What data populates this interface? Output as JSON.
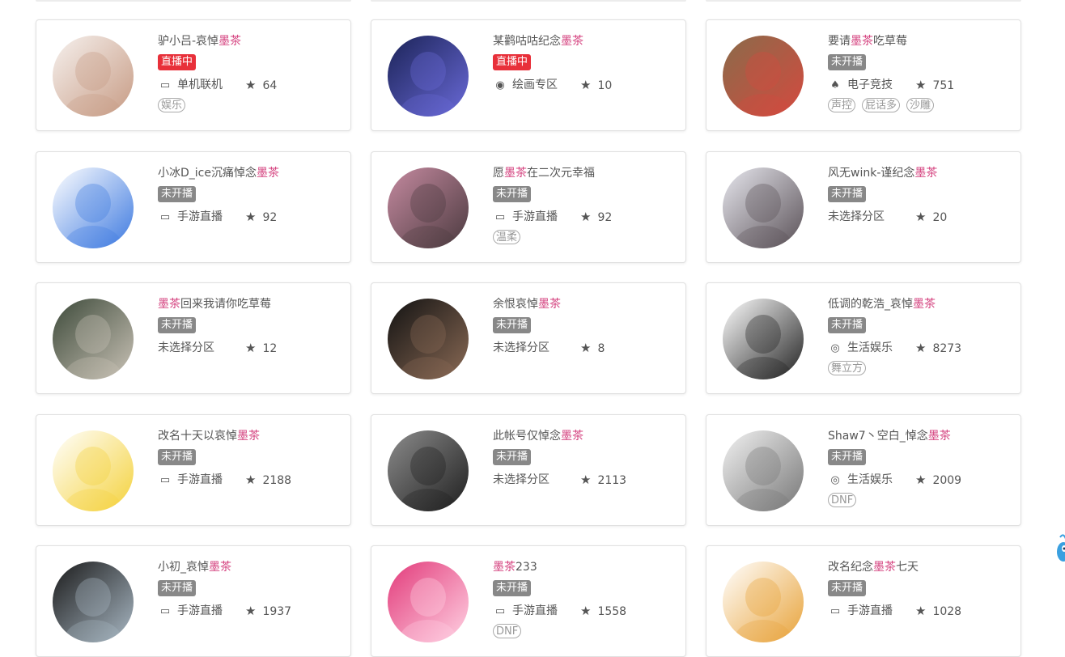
{
  "cards": [
    {
      "name_parts": [
        "驴小吕-哀悼",
        "墨茶",
        ""
      ],
      "status": "直播中",
      "live": true,
      "category": "单机联机",
      "cat_icon": "gamepad-icon",
      "fans": "64",
      "tags": [
        "娱乐"
      ],
      "avatar_colors": [
        "#f6f1ee",
        "#c79b84"
      ]
    },
    {
      "name_parts": [
        "某鹳咕咕纪念",
        "墨茶",
        ""
      ],
      "status": "直播中",
      "live": true,
      "category": "绘画专区",
      "cat_icon": "palette-icon",
      "fans": "10",
      "tags": [],
      "avatar_colors": [
        "#1b2357",
        "#6a6ad8"
      ]
    },
    {
      "name_parts": [
        "要请",
        "墨茶",
        "吃草莓"
      ],
      "status": "未开播",
      "live": false,
      "category": "电子竞技",
      "cat_icon": "trophy-icon",
      "fans": "751",
      "tags": [
        "声控",
        "屁话多",
        "沙雕"
      ],
      "avatar_colors": [
        "#8a6b4a",
        "#d44a3f"
      ]
    },
    {
      "name_parts": [
        "小冰D_ice沉痛悼念",
        "墨茶",
        ""
      ],
      "status": "未开播",
      "live": false,
      "category": "手游直播",
      "cat_icon": "gamepad-icon",
      "fans": "92",
      "tags": [],
      "avatar_colors": [
        "#ffffff",
        "#3e7ae0"
      ]
    },
    {
      "name_parts": [
        "愿",
        "墨茶",
        "在二次元幸福"
      ],
      "status": "未开播",
      "live": false,
      "category": "手游直播",
      "cat_icon": "gamepad-icon",
      "fans": "92",
      "tags": [
        "温柔"
      ],
      "avatar_colors": [
        "#c58aa0",
        "#4b3a3f"
      ]
    },
    {
      "name_parts": [
        "风无wink-谨纪念",
        "墨茶",
        ""
      ],
      "status": "未开播",
      "live": false,
      "category": "未选择分区",
      "cat_icon": "",
      "fans": "20",
      "tags": [],
      "avatar_colors": [
        "#e7e7ee",
        "#5a5157"
      ]
    },
    {
      "name_parts": [
        "",
        "墨茶",
        "回来我请你吃草莓"
      ],
      "status": "未开播",
      "live": false,
      "category": "未选择分区",
      "cat_icon": "",
      "fans": "12",
      "tags": [],
      "avatar_colors": [
        "#3d4a3a",
        "#c9c2b6"
      ]
    },
    {
      "name_parts": [
        "余恨哀悼",
        "墨茶",
        ""
      ],
      "status": "未开播",
      "live": false,
      "category": "未选择分区",
      "cat_icon": "",
      "fans": "8",
      "tags": [],
      "avatar_colors": [
        "#121212",
        "#8a6a55"
      ]
    },
    {
      "name_parts": [
        "低调的乾浩_哀悼",
        "墨茶",
        ""
      ],
      "status": "未开播",
      "live": false,
      "category": "生活娱乐",
      "cat_icon": "bubble-icon",
      "fans": "8273",
      "tags": [
        "舞立方"
      ],
      "avatar_colors": [
        "#ffffff",
        "#222222"
      ]
    },
    {
      "name_parts": [
        "改名十天以哀悼",
        "墨茶",
        ""
      ],
      "status": "未开播",
      "live": false,
      "category": "手游直播",
      "cat_icon": "gamepad-icon",
      "fans": "2188",
      "tags": [],
      "avatar_colors": [
        "#ffffff",
        "#f4d23c"
      ]
    },
    {
      "name_parts": [
        "此帐号仅悼念",
        "墨茶",
        ""
      ],
      "status": "未开播",
      "live": false,
      "category": "未选择分区",
      "cat_icon": "",
      "fans": "2113",
      "tags": [],
      "avatar_colors": [
        "#8c8c8c",
        "#1f1f1f"
      ]
    },
    {
      "name_parts": [
        "Shaw7丶空白_悼念",
        "墨茶",
        ""
      ],
      "status": "未开播",
      "live": false,
      "category": "生活娱乐",
      "cat_icon": "bubble-icon",
      "fans": "2009",
      "tags": [
        "DNF"
      ],
      "avatar_colors": [
        "#f2f2f2",
        "#777777"
      ]
    },
    {
      "name_parts": [
        "小初_哀悼",
        "墨茶",
        ""
      ],
      "status": "未开播",
      "live": false,
      "category": "手游直播",
      "cat_icon": "gamepad-icon",
      "fans": "1937",
      "tags": [],
      "avatar_colors": [
        "#1a1a1a",
        "#a9b8c4"
      ]
    },
    {
      "name_parts": [
        "",
        "墨茶",
        "233"
      ],
      "status": "未开播",
      "live": false,
      "category": "手游直播",
      "cat_icon": "gamepad-icon",
      "fans": "1558",
      "tags": [
        "DNF"
      ],
      "avatar_colors": [
        "#e23a7a",
        "#ffd2e3"
      ]
    },
    {
      "name_parts": [
        "改名纪念",
        "墨茶",
        "七天"
      ],
      "status": "未开播",
      "live": false,
      "category": "手游直播",
      "cat_icon": "gamepad-icon",
      "fans": "1028",
      "tags": [],
      "avatar_colors": [
        "#ffffff",
        "#e8a33a"
      ]
    }
  ]
}
